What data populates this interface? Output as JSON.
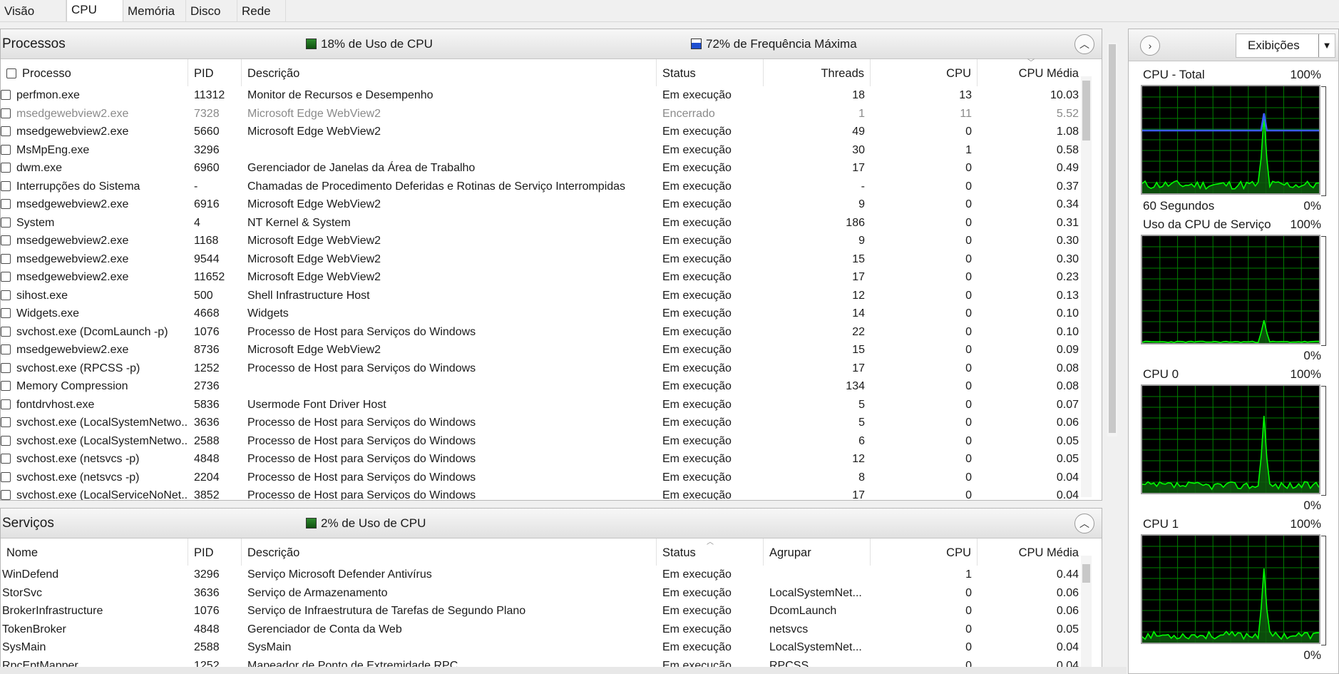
{
  "tabs": [
    {
      "label": "Visão Geral",
      "active": false
    },
    {
      "label": "CPU",
      "active": true
    },
    {
      "label": "Memória",
      "active": false
    },
    {
      "label": "Disco",
      "active": false
    },
    {
      "label": "Rede",
      "active": false
    }
  ],
  "processes": {
    "title": "Processos",
    "cpu_usage": "18% de Uso de CPU",
    "max_freq": "72% de Frequência Máxima",
    "columns": [
      "Processo",
      "PID",
      "Descrição",
      "Status",
      "Threads",
      "CPU",
      "CPU Média"
    ],
    "rows": [
      {
        "name": "perfmon.exe",
        "pid": "11312",
        "desc": "Monitor de Recursos e Desempenho",
        "status": "Em execução",
        "threads": "18",
        "cpu": "13",
        "avg": "10.03"
      },
      {
        "name": "msedgewebview2.exe",
        "pid": "7328",
        "desc": "Microsoft Edge WebView2",
        "status": "Encerrado",
        "threads": "1",
        "cpu": "11",
        "avg": "5.52",
        "ended": true
      },
      {
        "name": "msedgewebview2.exe",
        "pid": "5660",
        "desc": "Microsoft Edge WebView2",
        "status": "Em execução",
        "threads": "49",
        "cpu": "0",
        "avg": "1.08"
      },
      {
        "name": "MsMpEng.exe",
        "pid": "3296",
        "desc": "",
        "status": "Em execução",
        "threads": "30",
        "cpu": "1",
        "avg": "0.58"
      },
      {
        "name": "dwm.exe",
        "pid": "6960",
        "desc": "Gerenciador de Janelas da Área de Trabalho",
        "status": "Em execução",
        "threads": "17",
        "cpu": "0",
        "avg": "0.49"
      },
      {
        "name": "Interrupções do Sistema",
        "pid": "-",
        "desc": "Chamadas de Procedimento Deferidas e Rotinas de Serviço Interrompidas",
        "status": "Em execução",
        "threads": "-",
        "cpu": "0",
        "avg": "0.37"
      },
      {
        "name": "msedgewebview2.exe",
        "pid": "6916",
        "desc": "Microsoft Edge WebView2",
        "status": "Em execução",
        "threads": "9",
        "cpu": "0",
        "avg": "0.34"
      },
      {
        "name": "System",
        "pid": "4",
        "desc": "NT Kernel & System",
        "status": "Em execução",
        "threads": "186",
        "cpu": "0",
        "avg": "0.31"
      },
      {
        "name": "msedgewebview2.exe",
        "pid": "1168",
        "desc": "Microsoft Edge WebView2",
        "status": "Em execução",
        "threads": "9",
        "cpu": "0",
        "avg": "0.30"
      },
      {
        "name": "msedgewebview2.exe",
        "pid": "9544",
        "desc": "Microsoft Edge WebView2",
        "status": "Em execução",
        "threads": "15",
        "cpu": "0",
        "avg": "0.30"
      },
      {
        "name": "msedgewebview2.exe",
        "pid": "11652",
        "desc": "Microsoft Edge WebView2",
        "status": "Em execução",
        "threads": "17",
        "cpu": "0",
        "avg": "0.23"
      },
      {
        "name": "sihost.exe",
        "pid": "500",
        "desc": "Shell Infrastructure Host",
        "status": "Em execução",
        "threads": "12",
        "cpu": "0",
        "avg": "0.13"
      },
      {
        "name": "Widgets.exe",
        "pid": "4668",
        "desc": "Widgets",
        "status": "Em execução",
        "threads": "14",
        "cpu": "0",
        "avg": "0.10"
      },
      {
        "name": "svchost.exe (DcomLaunch -p)",
        "pid": "1076",
        "desc": "Processo de Host para Serviços do Windows",
        "status": "Em execução",
        "threads": "22",
        "cpu": "0",
        "avg": "0.10"
      },
      {
        "name": "msedgewebview2.exe",
        "pid": "8736",
        "desc": "Microsoft Edge WebView2",
        "status": "Em execução",
        "threads": "15",
        "cpu": "0",
        "avg": "0.09"
      },
      {
        "name": "svchost.exe (RPCSS -p)",
        "pid": "1252",
        "desc": "Processo de Host para Serviços do Windows",
        "status": "Em execução",
        "threads": "17",
        "cpu": "0",
        "avg": "0.08"
      },
      {
        "name": "Memory Compression",
        "pid": "2736",
        "desc": "",
        "status": "Em execução",
        "threads": "134",
        "cpu": "0",
        "avg": "0.08"
      },
      {
        "name": "fontdrvhost.exe",
        "pid": "5836",
        "desc": "Usermode Font Driver Host",
        "status": "Em execução",
        "threads": "5",
        "cpu": "0",
        "avg": "0.07"
      },
      {
        "name": "svchost.exe (LocalSystemNetwo...",
        "pid": "3636",
        "desc": "Processo de Host para Serviços do Windows",
        "status": "Em execução",
        "threads": "5",
        "cpu": "0",
        "avg": "0.06"
      },
      {
        "name": "svchost.exe (LocalSystemNetwo...",
        "pid": "2588",
        "desc": "Processo de Host para Serviços do Windows",
        "status": "Em execução",
        "threads": "6",
        "cpu": "0",
        "avg": "0.05"
      },
      {
        "name": "svchost.exe (netsvcs -p)",
        "pid": "4848",
        "desc": "Processo de Host para Serviços do Windows",
        "status": "Em execução",
        "threads": "12",
        "cpu": "0",
        "avg": "0.05"
      },
      {
        "name": "svchost.exe (netsvcs -p)",
        "pid": "2204",
        "desc": "Processo de Host para Serviços do Windows",
        "status": "Em execução",
        "threads": "8",
        "cpu": "0",
        "avg": "0.04"
      },
      {
        "name": "svchost.exe (LocalServiceNoNet...",
        "pid": "3852",
        "desc": "Processo de Host para Serviços do Windows",
        "status": "Em execução",
        "threads": "17",
        "cpu": "0",
        "avg": "0.04"
      }
    ]
  },
  "services": {
    "title": "Serviços",
    "cpu_usage": "2% de Uso de CPU",
    "columns": [
      "Nome",
      "PID",
      "Descrição",
      "Status",
      "Agrupar",
      "CPU",
      "CPU Média"
    ],
    "rows": [
      {
        "name": "WinDefend",
        "pid": "3296",
        "desc": "Serviço Microsoft Defender Antivírus",
        "status": "Em execução",
        "group": "",
        "cpu": "1",
        "avg": "0.44"
      },
      {
        "name": "StorSvc",
        "pid": "3636",
        "desc": "Serviço de Armazenamento",
        "status": "Em execução",
        "group": "LocalSystemNet...",
        "cpu": "0",
        "avg": "0.06"
      },
      {
        "name": "BrokerInfrastructure",
        "pid": "1076",
        "desc": "Serviço de Infraestrutura de Tarefas de Segundo Plano",
        "status": "Em execução",
        "group": "DcomLaunch",
        "cpu": "0",
        "avg": "0.06"
      },
      {
        "name": "TokenBroker",
        "pid": "4848",
        "desc": "Gerenciador de Conta da Web",
        "status": "Em execução",
        "group": "netsvcs",
        "cpu": "0",
        "avg": "0.05"
      },
      {
        "name": "SysMain",
        "pid": "2588",
        "desc": "SysMain",
        "status": "Em execução",
        "group": "LocalSystemNet...",
        "cpu": "0",
        "avg": "0.04"
      },
      {
        "name": "RpcEptMapper",
        "pid": "1252",
        "desc": "Mapeador de Ponto de Extremidade RPC",
        "status": "Em execução",
        "group": "RPCSS",
        "cpu": "0",
        "avg": "0.04"
      }
    ]
  },
  "right_panel": {
    "views_label": "Exibições",
    "graphs": [
      {
        "title": "CPU - Total",
        "max": "100%",
        "bottom_left": "60 Segundos",
        "min": "0%"
      },
      {
        "title": "Uso da CPU de Serviço",
        "max": "100%",
        "bottom_left": "",
        "min": "0%"
      },
      {
        "title": "CPU 0",
        "max": "100%",
        "bottom_left": "",
        "min": "0%"
      },
      {
        "title": "CPU 1",
        "max": "100%",
        "bottom_left": "",
        "min": "0%"
      }
    ]
  },
  "colors": {
    "graph_bg": "#000000",
    "graph_grid": "#008000",
    "graph_line": "#00ff00",
    "freq_line": "#3a5cff"
  }
}
